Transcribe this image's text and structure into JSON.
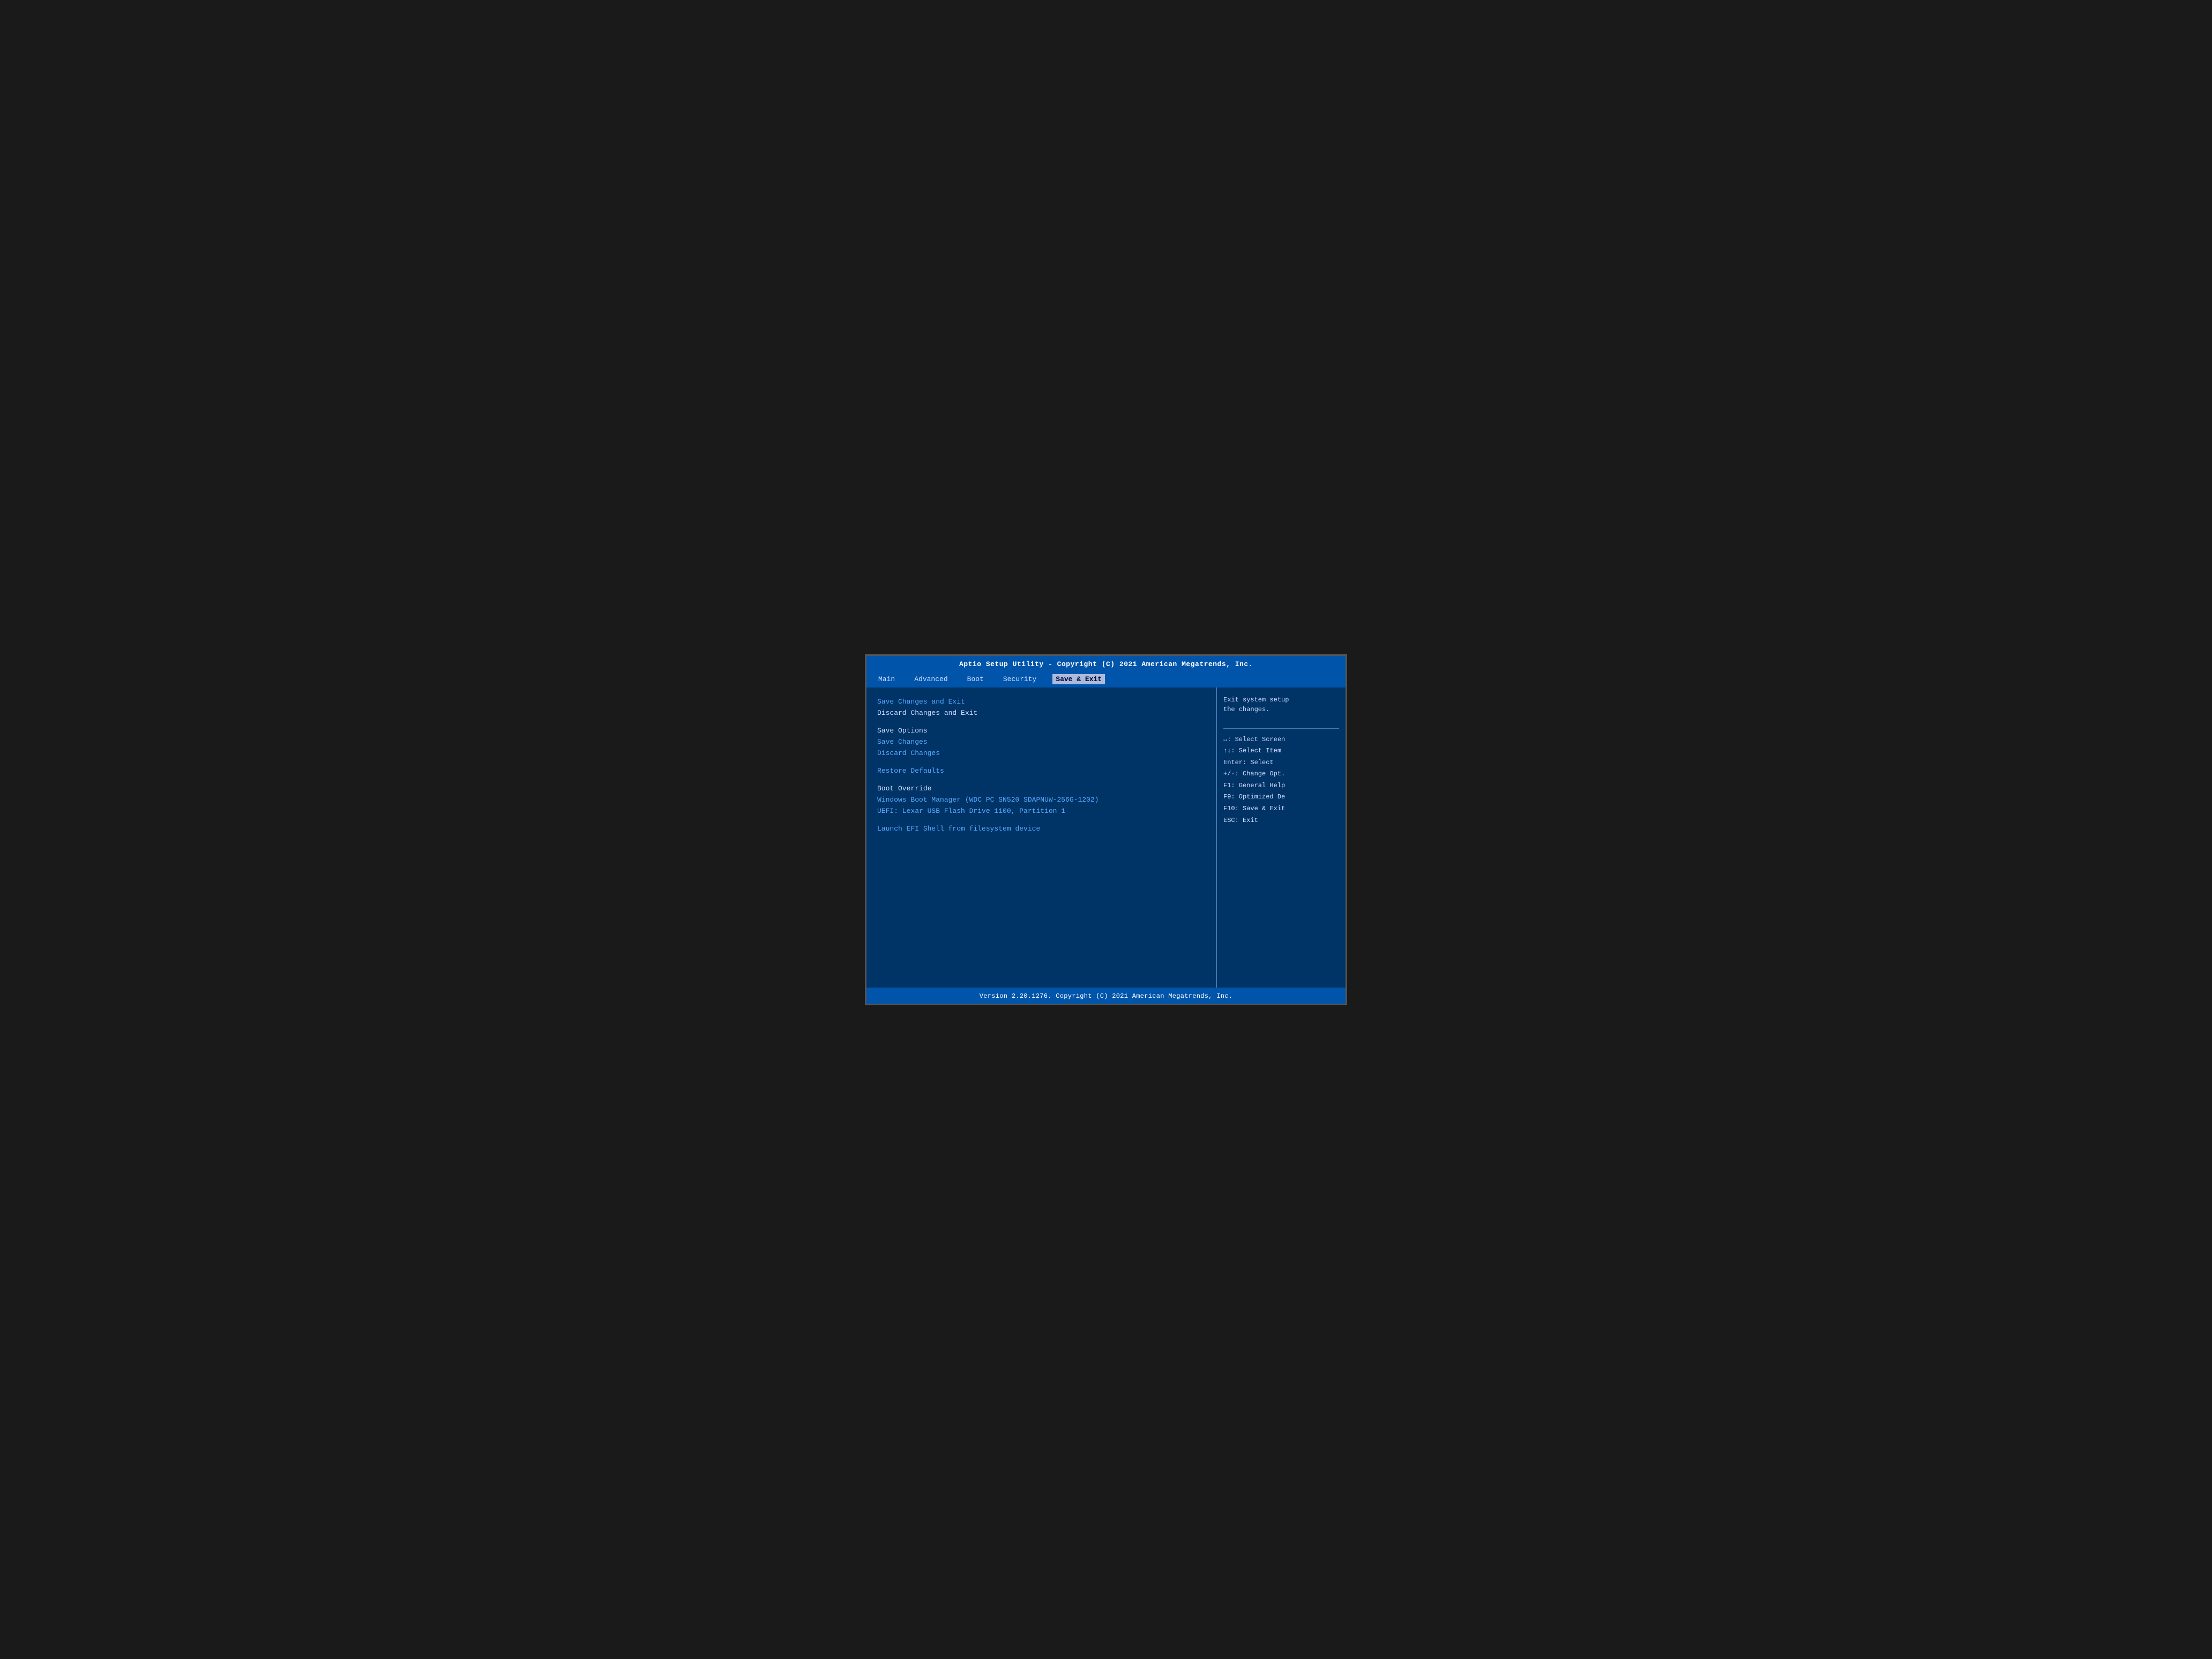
{
  "header": {
    "title": "Aptio Setup Utility - Copyright (C) 2021 American Megatrends, Inc."
  },
  "nav": {
    "items": [
      {
        "label": "Main",
        "active": false
      },
      {
        "label": "Advanced",
        "active": false
      },
      {
        "label": "Boot",
        "active": false
      },
      {
        "label": "Security",
        "active": false
      },
      {
        "label": "Save & Exit",
        "active": true
      }
    ]
  },
  "menu": {
    "items": [
      {
        "label": "Save Changes and Exit",
        "clickable": true,
        "spacer_before": false
      },
      {
        "label": "Discard Changes and Exit",
        "clickable": false,
        "spacer_before": false
      },
      {
        "label": "",
        "spacer": true
      },
      {
        "label": "Save Options",
        "clickable": false,
        "spacer_before": false
      },
      {
        "label": "Save Changes",
        "clickable": false,
        "spacer_before": false
      },
      {
        "label": "Discard Changes",
        "clickable": false,
        "spacer_before": false
      },
      {
        "label": "",
        "spacer": true
      },
      {
        "label": "Restore Defaults",
        "clickable": false,
        "spacer_before": false
      },
      {
        "label": "",
        "spacer": true
      },
      {
        "label": "Boot Override",
        "clickable": false,
        "spacer_before": false
      },
      {
        "label": "Windows Boot Manager (WDC PC SN520 SDAPNUW-256G-1202)",
        "clickable": true,
        "spacer_before": false
      },
      {
        "label": "UEFI: Lexar USB Flash Drive 1100, Partition 1",
        "clickable": true,
        "spacer_before": false
      },
      {
        "label": "",
        "spacer": true
      },
      {
        "label": "Launch EFI Shell from filesystem device",
        "clickable": true,
        "spacer_before": false
      }
    ]
  },
  "help": {
    "description": "Exit system setup\nthe changes.",
    "keys": [
      "↔: Select Screen",
      "↑↓: Select Item",
      "Enter: Select",
      "+/-: Change Opt.",
      "F1: General Help",
      "F9: Optimized De",
      "F10: Save & Exit",
      "ESC: Exit"
    ]
  },
  "footer": {
    "text": "Version 2.20.1276. Copyright (C) 2021 American Megatrends, Inc."
  }
}
